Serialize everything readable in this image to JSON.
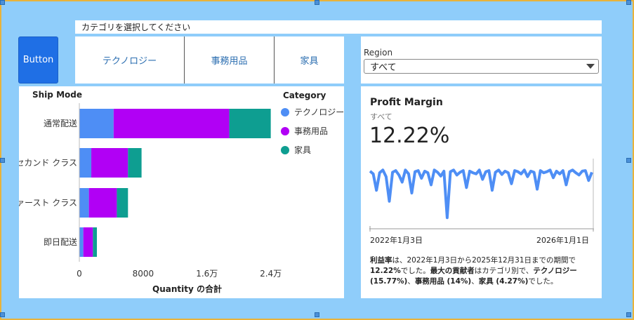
{
  "button": {
    "label": "Button"
  },
  "category_prompt": "カテゴリを選択してください",
  "tabs": [
    {
      "label": "テクノロジー"
    },
    {
      "label": "事務用品"
    },
    {
      "label": "家具"
    }
  ],
  "region": {
    "label": "Region",
    "value": "すべて"
  },
  "colors": {
    "technology": "#4e8ef5",
    "office": "#b100f5",
    "furniture": "#0e9e91",
    "accent": "#1f6fe5",
    "background": "#8fcdfa",
    "border": "#e8b23a"
  },
  "bar_chart": {
    "y_axis_title": "Ship Mode",
    "legend_title": "Category",
    "legend": [
      {
        "label": "テクノロジー",
        "color": "#4e8ef5"
      },
      {
        "label": "事務用品",
        "color": "#b100f5"
      },
      {
        "label": "家具",
        "color": "#0e9e91"
      }
    ],
    "x_ticks": [
      "0",
      "8000",
      "1.6万",
      "2.4万"
    ],
    "x_axis_title": "Quantity の合計"
  },
  "profit_margin": {
    "title": "Profit Margin",
    "subtitle": "すべて",
    "value": "12.22%",
    "date_start": "2022年1月3日",
    "date_end": "2026年1月1日",
    "narrative": {
      "p1_bold": "利益率",
      "p1": "は、2022年1月3日から2025年12月31日までの期間で",
      "p2_bold": "12.22%",
      "p2": "でした。",
      "p3_bold": "最大の貢献者",
      "p3": "はカテゴリ別で、",
      "p4_bold": "テクノロジー (15.77%)",
      "p4": "、",
      "p5_bold": "事務用品 (14%)",
      "p5": "、",
      "p6_bold": "家具 (4.27%)",
      "p6": "でした。"
    }
  },
  "chart_data": [
    {
      "type": "bar",
      "orientation": "horizontal",
      "stacked": true,
      "categories": [
        "通常配送",
        "セカンド クラス",
        "ファースト クラス",
        "即日配送"
      ],
      "series": [
        {
          "name": "テクノロジー",
          "values": [
            4300,
            1500,
            1200,
            500
          ]
        },
        {
          "name": "事務用品",
          "values": [
            14500,
            4600,
            3500,
            1200
          ]
        },
        {
          "name": "家具",
          "values": [
            5200,
            1700,
            1400,
            500
          ]
        }
      ],
      "title": "",
      "xlabel": "Quantity の合計",
      "ylabel": "Ship Mode",
      "xlim": [
        0,
        25000
      ],
      "legend": "right",
      "grid": false
    },
    {
      "type": "line",
      "title": "Profit Margin",
      "x_range": [
        "2022年1月3日",
        "2026年1月1日"
      ],
      "description_points": "daily profit margin, mostly near top of range with frequent downward spikes",
      "values": [
        0.95,
        0.9,
        0.6,
        0.92,
        0.97,
        0.85,
        0.4,
        0.93,
        0.96,
        0.88,
        0.75,
        0.97,
        0.9,
        0.55,
        0.94,
        0.96,
        0.82,
        0.95,
        0.92,
        0.7,
        0.97,
        0.93,
        0.86,
        0.95,
        0.1,
        0.94,
        0.97,
        0.88,
        0.93,
        0.96,
        0.65,
        0.95,
        0.92,
        0.9,
        0.97,
        0.8,
        0.94,
        0.96,
        0.6,
        0.93,
        0.97,
        0.89,
        0.95,
        0.92,
        0.72,
        0.96,
        0.94,
        0.9,
        0.97,
        0.85,
        0.95,
        0.93,
        0.62,
        0.96,
        0.92,
        0.94,
        0.97,
        0.83,
        0.95,
        0.9,
        0.96,
        0.7,
        0.94,
        0.97,
        0.92,
        0.88,
        0.95,
        0.96,
        0.78,
        0.93
      ]
    }
  ]
}
